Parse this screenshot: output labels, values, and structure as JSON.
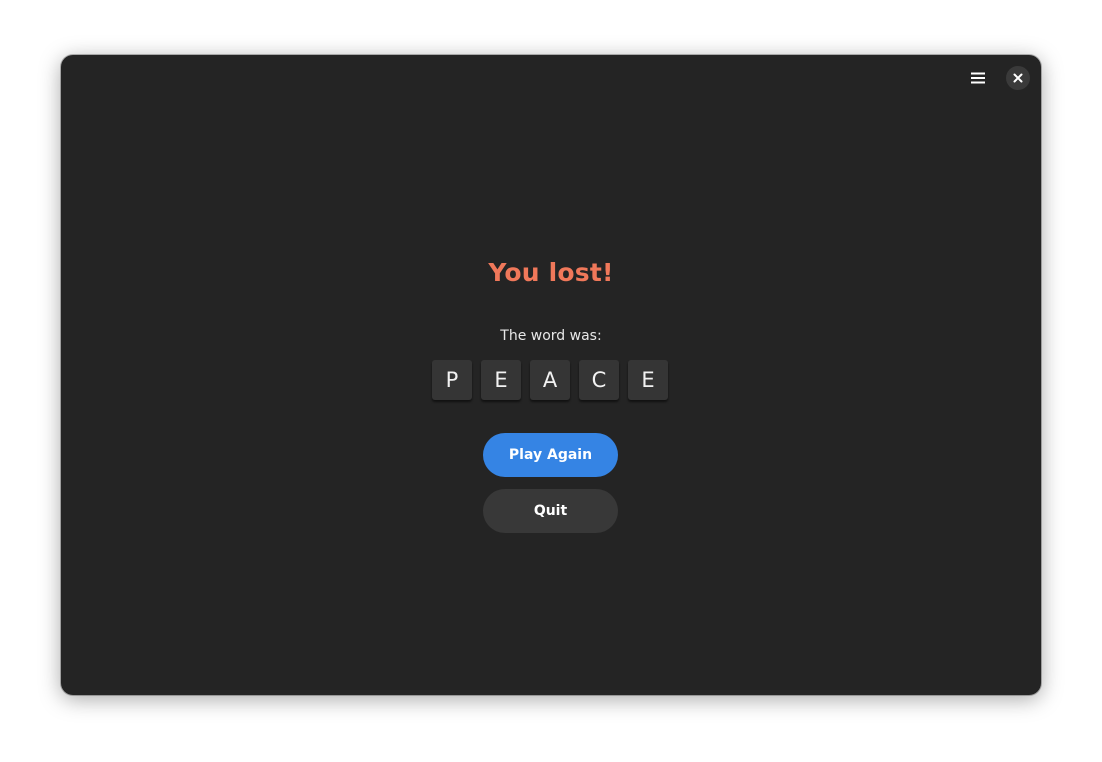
{
  "game": {
    "title": "You lost!",
    "subtitle": "The word was:",
    "letters": [
      "P",
      "E",
      "A",
      "C",
      "E"
    ]
  },
  "buttons": {
    "play_again": "Play Again",
    "quit": "Quit"
  },
  "icons": {
    "menu": "hamburger-menu-icon",
    "close": "close-icon"
  },
  "colors": {
    "window_bg": "#242424",
    "title": "#f0785a",
    "primary_button": "#3584e4",
    "secondary_button": "#383838",
    "tile_bg": "#353535"
  }
}
